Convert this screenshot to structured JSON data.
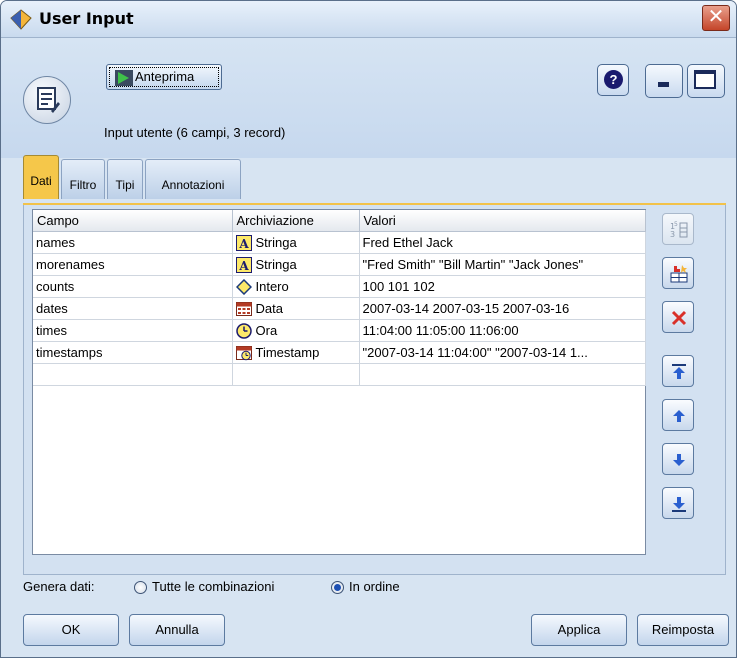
{
  "window": {
    "title": "User Input"
  },
  "toolbar": {
    "preview_label": "Anteprima"
  },
  "summary": "Input utente (6 campi, 3 record)",
  "tabs": [
    {
      "label": "Dati",
      "active": true
    },
    {
      "label": "Filtro",
      "active": false
    },
    {
      "label": "Tipi",
      "active": false
    },
    {
      "label": "Annotazioni",
      "active": false
    }
  ],
  "table": {
    "columns": [
      "Campo",
      "Archiviazione",
      "Valori"
    ],
    "rows": [
      {
        "field": "names",
        "storage": "Stringa",
        "storage_icon": "string-icon",
        "values": "Fred Ethel Jack"
      },
      {
        "field": "morenames",
        "storage": "Stringa",
        "storage_icon": "string-icon",
        "values": "\"Fred Smith\" \"Bill Martin\" \"Jack Jones\""
      },
      {
        "field": "counts",
        "storage": "Intero",
        "storage_icon": "integer-icon",
        "values": "100 101 102"
      },
      {
        "field": "dates",
        "storage": "Data",
        "storage_icon": "date-icon",
        "values": "2007-03-14 2007-03-15 2007-03-16"
      },
      {
        "field": "times",
        "storage": "Ora",
        "storage_icon": "time-icon",
        "values": "11:04:00 11:05:00 11:06:00"
      },
      {
        "field": "timestamps",
        "storage": "Timestamp",
        "storage_icon": "timestamp-icon",
        "values": "\"2007-03-14 11:04:00\" \"2007-03-14 1..."
      }
    ]
  },
  "generate": {
    "label": "Genera dati:",
    "options": [
      {
        "label": "Tutte le combinazioni",
        "checked": false
      },
      {
        "label": "In ordine",
        "checked": true
      }
    ]
  },
  "buttons": {
    "ok": "OK",
    "cancel": "Annulla",
    "apply": "Applica",
    "reset": "Reimposta"
  },
  "colors": {
    "active_tab": "#f5c74a",
    "close": "#c4452a",
    "accent": "#1c4fb3"
  }
}
